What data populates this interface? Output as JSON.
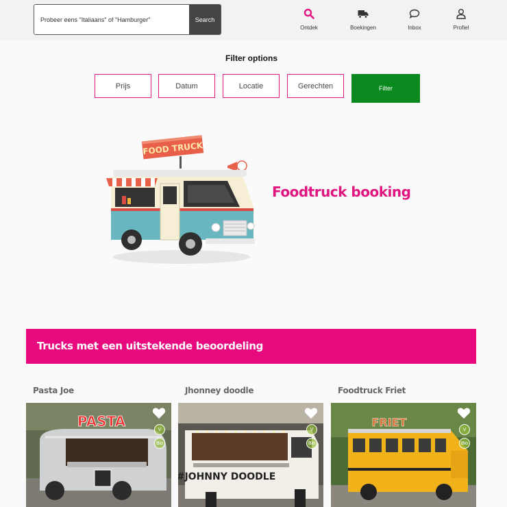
{
  "search": {
    "placeholder": "Probeer eens \"Italiaans\" of \"Hamburger\"",
    "button_label": "Search"
  },
  "nav": [
    {
      "label": "Ontdek",
      "icon": "search-icon",
      "active": true
    },
    {
      "label": "Boekingen",
      "icon": "truck-icon"
    },
    {
      "label": "Inbox",
      "icon": "chat-icon"
    },
    {
      "label": "Profiel",
      "icon": "user-icon"
    }
  ],
  "filter": {
    "title": "Filter options",
    "options": [
      "Prijs",
      "Datum",
      "Locatie",
      "Gerechten"
    ],
    "submit_label": "Filter"
  },
  "hero": {
    "title": "Foodtruck booking",
    "sign_text": "FOOD TRUCK"
  },
  "banner": {
    "text": "Trucks met een uitstekende beoordeling"
  },
  "trucks": [
    {
      "name": "Pasta Joe",
      "veg_badge": "V",
      "bio_badge": "Bio",
      "sign": "PASTA"
    },
    {
      "name": "Jhonney doodle",
      "veg_badge": "V",
      "bio_badge": "Bio",
      "sign": "#JOHNNY DOODLE"
    },
    {
      "name": "Foodtruck Friet",
      "veg_badge": "V",
      "bio_badge": "Bio",
      "sign": "FRIET"
    }
  ],
  "colors": {
    "accent": "#e0157f",
    "filter_button": "#0a8a1e",
    "search_button": "#444444"
  }
}
